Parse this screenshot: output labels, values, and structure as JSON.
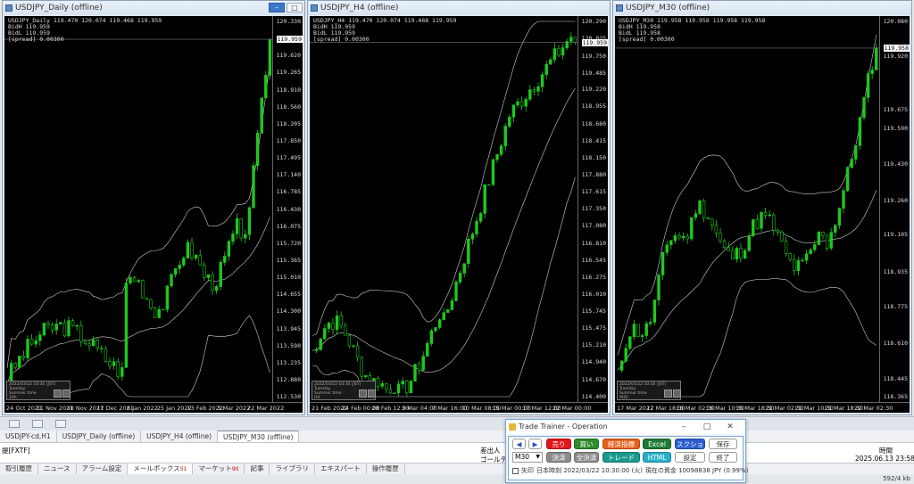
{
  "charts": [
    {
      "title": "USDJPY_Daily (offline)",
      "info": [
        "USDJPY_Daily 119.470 120.074 119.468 119.959",
        "BidH 119.959",
        "BidL 119.959",
        "[spread] 0.00300"
      ],
      "prices": [
        "120.330",
        "119.959",
        "119.620",
        "119.265",
        "118.910",
        "118.560",
        "118.205",
        "117.850",
        "117.495",
        "117.140",
        "116.785",
        "116.430",
        "116.075",
        "115.720",
        "115.365",
        "115.010",
        "114.655",
        "114.300",
        "113.945",
        "113.590",
        "113.235",
        "112.880",
        "112.530"
      ],
      "current_price": "119.959",
      "times": [
        "24 Oct 2021",
        "11 Nov 2021",
        "30 Nov 2021",
        "17 Dec 2021",
        "6 Jan 2022",
        "25 Jan 2022",
        "13 Feb 2022",
        "3 Mar 2022",
        "22 Mar 2022"
      ],
      "mini_info": [
        "2022/03/22 10:30 (JST)",
        "Tuesday",
        "Summer time",
        "24h"
      ],
      "series": {
        "start": 112.9,
        "end": 119.959,
        "min": 112.53,
        "max": 120.33,
        "seed": 3,
        "shape": "daily"
      }
    },
    {
      "title": "USDJPY_H4 (offline)",
      "info": [
        "USDJPY_H4 119.470 120.074 119.468 119.959",
        "BidH 119.959",
        "BidL 119.959",
        "[spread] 0.00300"
      ],
      "prices": [
        "120.290",
        "120.025",
        "119.959",
        "119.750",
        "119.485",
        "119.220",
        "118.955",
        "118.680",
        "118.415",
        "118.150",
        "117.880",
        "117.615",
        "117.350",
        "117.080",
        "116.810",
        "116.545",
        "116.275",
        "116.010",
        "115.745",
        "115.475",
        "115.210",
        "114.940",
        "114.670",
        "114.400"
      ],
      "current_price": "119.959",
      "times": [
        "21 Feb 2022",
        "24 Feb 00:00",
        "28 Feb 12:00",
        "3 Mar 04:00",
        "7 Mar 16:00",
        "10 Mar 08:00",
        "15 Mar 00:00",
        "17 Mar 12:00",
        "22 Mar 00:00"
      ],
      "mini_info": [
        "2022/03/22 10:30 (JST)",
        "Tuesday",
        "Summer time",
        "H4"
      ],
      "series": {
        "start": 114.8,
        "end": 119.959,
        "min": 114.4,
        "max": 120.29,
        "seed": 7,
        "shape": "h4"
      }
    },
    {
      "title": "USDJPY_M30 (offline)",
      "info": [
        "USDJPY_M30 119.958 119.958 119.958 119.958",
        "BidH 119.958",
        "BidL 119.958",
        "[spread] 0.00300"
      ],
      "prices": [
        "120.080",
        "119.958",
        "119.920",
        "119.675",
        "119.590",
        "119.430",
        "119.260",
        "119.105",
        "118.935",
        "118.775",
        "118.610",
        "118.445",
        "118.365"
      ],
      "current_price": "119.958",
      "times": [
        "17 Mar 2022",
        "17 Mar 18:30",
        "18 Mar 02:30",
        "18 Mar 10:30",
        "18 Mar 18:30",
        "21 Mar 02:30",
        "21 Mar 10:30",
        "21 Mar 18:30",
        "22 Mar 02:30"
      ],
      "mini_info": [
        "2022/03/22 10:30 (JST)",
        "Tuesday",
        "Summer time",
        "M30"
      ],
      "series": {
        "start": 118.45,
        "end": 119.958,
        "min": 118.365,
        "max": 120.08,
        "seed": 11,
        "shape": "m30"
      }
    }
  ],
  "doc_tabs": [
    "USDJPY-cd,H1",
    "USDJPY_Daily (offline)",
    "USDJPY_H4 (offline)",
    "USDJPY_M30 (offline)"
  ],
  "terminal": {
    "left_label": "提[FXTF]",
    "col_submitter": "差出人",
    "row_gold": "ゴールデン",
    "col_time": "時間",
    "row_time": "2025.06.13 23:58"
  },
  "bottom_tabs": [
    {
      "label": "取引履歴"
    },
    {
      "label": "ニュース"
    },
    {
      "label": "アラーム設定"
    },
    {
      "label": "メールボックス",
      "count": "51"
    },
    {
      "label": "マーケット",
      "count": "90"
    },
    {
      "label": "記事"
    },
    {
      "label": "ライブラリ"
    },
    {
      "label": "エキスパート"
    },
    {
      "label": "操作履歴"
    }
  ],
  "status_right": "592/4 kb",
  "trader": {
    "title": "Trade Trainer - Operation",
    "prev": "◀",
    "next": "▶",
    "sell": "売り",
    "buy": "買い",
    "econ": "経済指標",
    "excel": "Excel",
    "screenshot": "スクショ",
    "save": "保存",
    "timeframe": "M30",
    "settle": "決済",
    "settle_all": "全決済",
    "trade": "トレード",
    "html": "HTML",
    "settings": "設定",
    "exit": "終了",
    "arrow_label": "矢印",
    "jp_time": "日本時刻 2022/03/22 10:30:00 (火)",
    "balance": "現在の資金 10098838 JPY (0.99%)"
  },
  "colors": {
    "sell": "#e0161b",
    "buy": "#2e8b2e",
    "econ": "#e8611a",
    "excel": "#1f7a34",
    "screenshot": "#2c5fd1",
    "settle": "#8c8c8c",
    "settle_all": "#8c8c8c",
    "trade": "#1b9a8c",
    "html": "#28b0c8",
    "nav": "#1e4fbf",
    "candle": "#1ec81e"
  }
}
